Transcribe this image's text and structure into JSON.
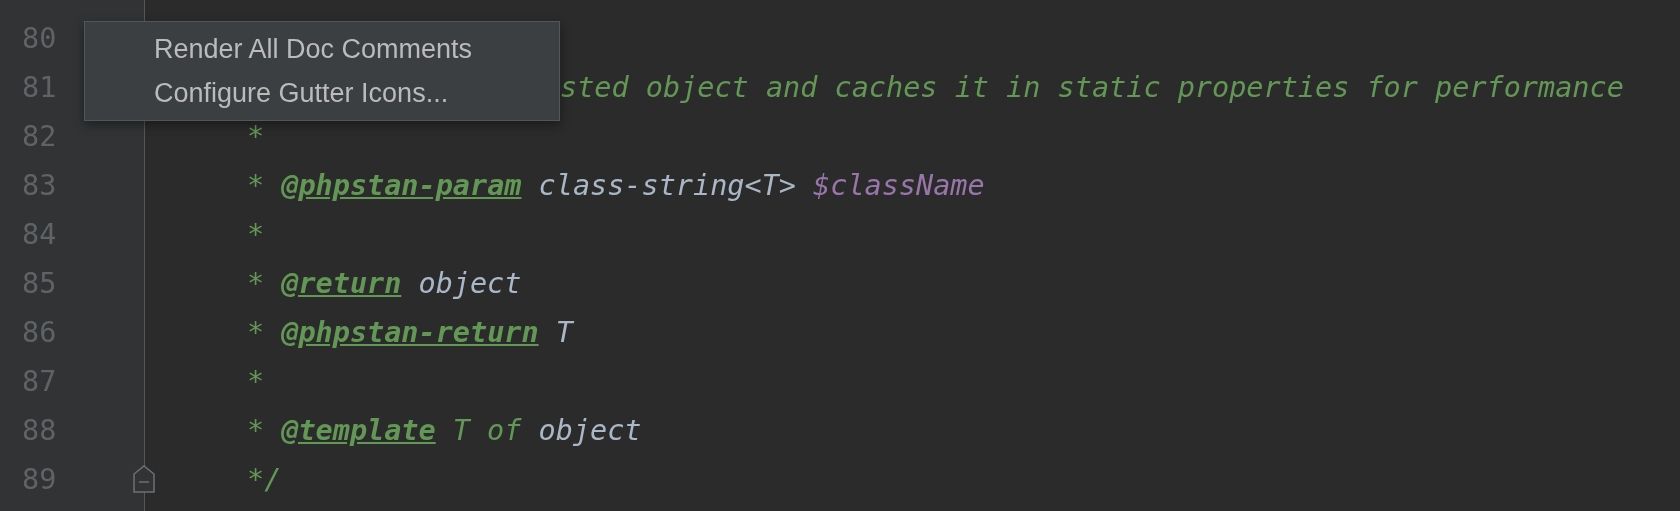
{
  "lines": [
    {
      "number": "80"
    },
    {
      "number": "81",
      "tokens": [
        {
          "kind": "comment-cut",
          "text": "sted object and caches it in static properties for performance"
        }
      ]
    },
    {
      "number": "82",
      "tokens": [
        {
          "kind": "comment",
          "text": "*"
        }
      ]
    },
    {
      "number": "83",
      "tokens": [
        {
          "kind": "comment",
          "text": "*"
        },
        {
          "kind": "tag",
          "text": "@phpstan-param"
        },
        {
          "kind": "type",
          "text": "class-string<T>"
        },
        {
          "kind": "variable",
          "text": "$className"
        }
      ]
    },
    {
      "number": "84",
      "tokens": [
        {
          "kind": "comment",
          "text": "*"
        }
      ]
    },
    {
      "number": "85",
      "tokens": [
        {
          "kind": "comment",
          "text": "*"
        },
        {
          "kind": "tag",
          "text": "@return"
        },
        {
          "kind": "type",
          "text": "object"
        }
      ]
    },
    {
      "number": "86",
      "tokens": [
        {
          "kind": "comment",
          "text": "*"
        },
        {
          "kind": "tag",
          "text": "@phpstan-return"
        },
        {
          "kind": "type",
          "text": "T"
        }
      ]
    },
    {
      "number": "87",
      "tokens": [
        {
          "kind": "comment",
          "text": "*"
        }
      ]
    },
    {
      "number": "88",
      "tokens": [
        {
          "kind": "comment",
          "text": "*"
        },
        {
          "kind": "tag",
          "text": "@template"
        },
        {
          "kind": "comment",
          "text": "T of"
        },
        {
          "kind": "type",
          "text": "object"
        }
      ]
    },
    {
      "number": "89",
      "fold": true,
      "tokens": [
        {
          "kind": "comment",
          "text": "*/"
        }
      ]
    }
  ],
  "context_menu": {
    "items": [
      "Render All Doc Comments",
      "Configure Gutter Icons..."
    ]
  }
}
